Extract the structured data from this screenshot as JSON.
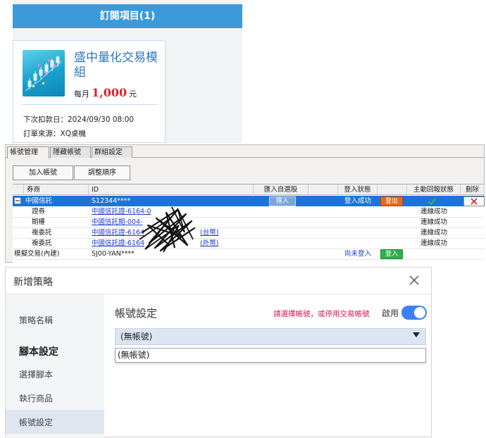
{
  "subscription": {
    "header": "訂閱項目(1)",
    "product_name": "盛中量化交易模組",
    "price_prefix": "每月",
    "price_amount": "1,000",
    "price_suffix": "元",
    "next_charge": "下次扣款日：2024/09/30 08:00",
    "order_source": "訂單來源：XQ桌機",
    "colors": {
      "header_bg": "#3d9ad9",
      "price": "#d9232b",
      "name": "#2f78b9"
    },
    "thumb_icon": "candlestick-chart-icon"
  },
  "account_manager": {
    "tabs": [
      "帳號管理",
      "隱藏帳號",
      "群組設定"
    ],
    "buttons": {
      "add": "加入帳號",
      "reorder": "調整順序"
    },
    "columns": [
      "券商",
      "ID",
      "匯入自選股",
      "登入狀態",
      "主動回報狀態",
      "刪除"
    ],
    "rows": [
      {
        "broker": "中國信託",
        "id": "S12344****",
        "import": "匯入",
        "login": "登入成功",
        "logout": "登出",
        "selected": true
      },
      {
        "broker": "證券",
        "id": "中國信託證-6164-0",
        "report": "連線成功"
      },
      {
        "broker": "期權",
        "id": "中國信託期-004-",
        "report": "連線成功"
      },
      {
        "broker": "複委託",
        "id": "中國信託證-6164",
        "id_suffix": "(台幣)",
        "report": "連線成功"
      },
      {
        "broker": "複委託",
        "id": "中國信託證-6164",
        "id_suffix": "(外幣)",
        "report": "連線成功"
      },
      {
        "broker": "模擬交易(內建)",
        "id": "SJ00-YAN****",
        "login": "尚未登入",
        "login_btn": "登入"
      }
    ],
    "collapse_icon": "minus-box-icon",
    "check_icon": "green-check-icon",
    "delete_icon": "red-x-icon"
  },
  "new_strategy": {
    "title": "新增策略",
    "sidebar": {
      "strategy_name": "策略名稱",
      "script_settings": "腳本設定",
      "choose_script": "選擇腳本",
      "exec_product": "執行商品",
      "account_settings": "帳號設定"
    },
    "section_title": "帳號設定",
    "warning": "請選擇帳號，或停用交易帳號",
    "enable_label": "啟用",
    "enabled": true,
    "select_value": "(無帳號)",
    "options": [
      "(無帳號)"
    ],
    "colors": {
      "warning": "#d1184a",
      "toggle": "#3b82f6",
      "select_bg": "#dbe5f3"
    }
  }
}
